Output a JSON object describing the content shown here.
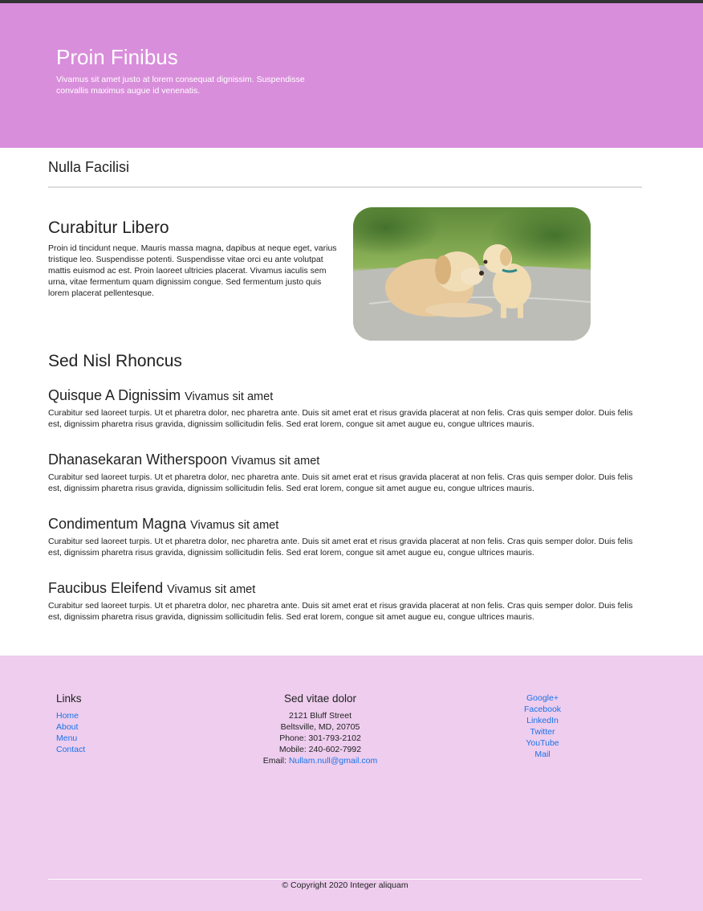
{
  "hero": {
    "title": "Proin Finibus",
    "subtitle": "Vivamus sit amet justo at lorem consequat dignissim. Suspendisse convallis maximus augue id venenatis."
  },
  "section": {
    "title": "Nulla Facilisi"
  },
  "article": {
    "title": "Curabitur Libero",
    "body": "Proin id tincidunt neque. Mauris massa magna, dapibus at neque eget, varius tristique leo. Suspendisse potenti. Suspendisse vitae orci eu ante volutpat mattis euismod ac est. Proin laoreet ultricies placerat. Vivamus iaculis sem urna, vitae fermentum quam dignissim congue. Sed fermentum justo quis lorem placerat pellentesque.",
    "image": "two-dogs-photo"
  },
  "list": {
    "title": "Sed Nisl Rhoncus",
    "items": [
      {
        "name": "Quisque A Dignissim",
        "sub": "Vivamus sit amet",
        "text": "Curabitur sed laoreet turpis. Ut et pharetra dolor, nec pharetra ante. Duis sit amet erat et risus gravida placerat at non felis. Cras quis semper dolor. Duis felis est, dignissim pharetra risus gravida, dignissim sollicitudin felis. Sed erat lorem, congue sit amet augue eu, congue ultrices mauris."
      },
      {
        "name": "Dhanasekaran Witherspoon",
        "sub": "Vivamus sit amet",
        "text": "Curabitur sed laoreet turpis. Ut et pharetra dolor, nec pharetra ante. Duis sit amet erat et risus gravida placerat at non felis. Cras quis semper dolor. Duis felis est, dignissim pharetra risus gravida, dignissim sollicitudin felis. Sed erat lorem, congue sit amet augue eu, congue ultrices mauris."
      },
      {
        "name": "Condimentum Magna",
        "sub": "Vivamus sit amet",
        "text": "Curabitur sed laoreet turpis. Ut et pharetra dolor, nec pharetra ante. Duis sit amet erat et risus gravida placerat at non felis. Cras quis semper dolor. Duis felis est, dignissim pharetra risus gravida, dignissim sollicitudin felis. Sed erat lorem, congue sit amet augue eu, congue ultrices mauris."
      },
      {
        "name": "Faucibus Eleifend",
        "sub": "Vivamus sit amet",
        "text": "Curabitur sed laoreet turpis. Ut et pharetra dolor, nec pharetra ante. Duis sit amet erat et risus gravida placerat at non felis. Cras quis semper dolor. Duis felis est, dignissim pharetra risus gravida, dignissim sollicitudin felis. Sed erat lorem, congue sit amet augue eu, congue ultrices mauris."
      }
    ]
  },
  "footer": {
    "links_title": "Links",
    "links": [
      "Home",
      "About",
      "Menu",
      "Contact"
    ],
    "contact_title": "Sed vitae dolor",
    "street": "2121 Bluff Street",
    "city": "Beltsville, MD, 20705",
    "phone": "Phone: 301-793-2102",
    "mobile": "Mobile: 240-602-7992",
    "email_label": "Email:",
    "email": "Nullam.null@gmail.com",
    "social": [
      "Google+",
      "Facebook",
      "LinkedIn",
      "Twitter",
      "YouTube",
      "Mail"
    ],
    "copyright": "© Copyright 2020 Integer aliquam"
  },
  "colors": {
    "hero_bg": "#d98edb",
    "footer_bg": "#eecdee",
    "link": "#1a73e8"
  }
}
